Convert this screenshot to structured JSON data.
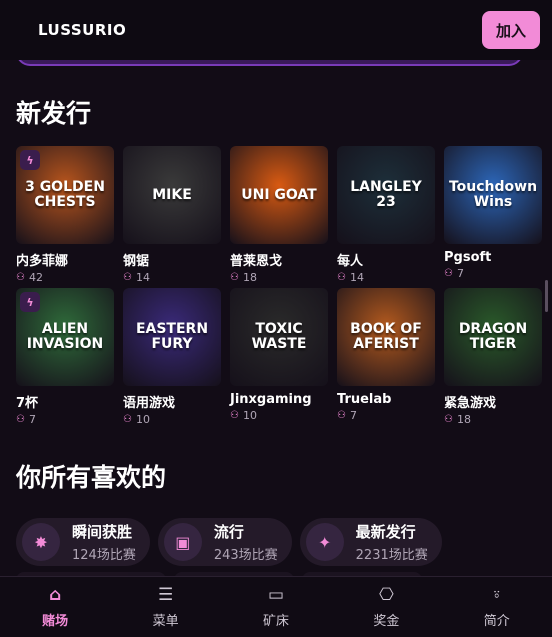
{
  "header": {
    "logo": "LUSSURIO",
    "join_label": "加入"
  },
  "sections": {
    "new_releases": "新发行",
    "favorites": "你所有喜欢的"
  },
  "games": [
    {
      "title": "内多菲娜",
      "count": "42",
      "art": "3 GOLDEN CHESTS",
      "bolt": true,
      "bg": "#b8551d"
    },
    {
      "title": "钢锯",
      "count": "14",
      "art": "MIKE",
      "bolt": false,
      "bg": "#3a3a3a"
    },
    {
      "title": "普莱恩戈",
      "count": "18",
      "art": "UNI GOAT",
      "bolt": false,
      "bg": "#d85a12"
    },
    {
      "title": "每人",
      "count": "14",
      "art": "LANGLEY 23",
      "bolt": false,
      "bg": "#1d2f3a"
    },
    {
      "title": "Pgsoft",
      "count": "7",
      "art": "Touchdown Wins",
      "bolt": false,
      "bg": "#2c66b8"
    },
    {
      "title": "7杯",
      "count": "7",
      "art": "ALIEN INVASION",
      "bolt": true,
      "bg": "#2f6b3a"
    },
    {
      "title": "语用游戏",
      "count": "10",
      "art": "EASTERN FURY",
      "bolt": false,
      "bg": "#3a2a7a"
    },
    {
      "title": "Jinxgaming",
      "count": "10",
      "art": "TOXIC WASTE",
      "bolt": false,
      "bg": "#2a2a2a"
    },
    {
      "title": "Truelab",
      "count": "7",
      "art": "BOOK OF AFERIST",
      "bolt": false,
      "bg": "#b45a1e"
    },
    {
      "title": "紧急游戏",
      "count": "18",
      "art": "DRAGON TIGER",
      "bolt": false,
      "bg": "#2a5a2a"
    }
  ],
  "categories": [
    {
      "title": "瞬间获胜",
      "sub": "124场比赛",
      "icon": "burst-icon",
      "glyph": "✸"
    },
    {
      "title": "流行",
      "sub": "243场比赛",
      "icon": "ticket-icon",
      "glyph": "▣"
    },
    {
      "title": "最新发行",
      "sub": "2231场比赛",
      "icon": "sparkle-icon",
      "glyph": "✦"
    }
  ],
  "nav": [
    {
      "label": "赌场",
      "icon": "home-icon",
      "glyph": "⌂",
      "active": true
    },
    {
      "label": "菜单",
      "icon": "menu-search-icon",
      "glyph": "☰",
      "active": false
    },
    {
      "label": "矿床",
      "icon": "wallet-icon",
      "glyph": "▭",
      "active": false
    },
    {
      "label": "奖金",
      "icon": "gift-icon",
      "glyph": "⎔",
      "active": false
    },
    {
      "label": "简介",
      "icon": "user-icon",
      "glyph": "⍤",
      "active": false
    }
  ],
  "colors": {
    "accent": "#f28bd7",
    "background": "#120c16",
    "pill": "#241a29"
  }
}
